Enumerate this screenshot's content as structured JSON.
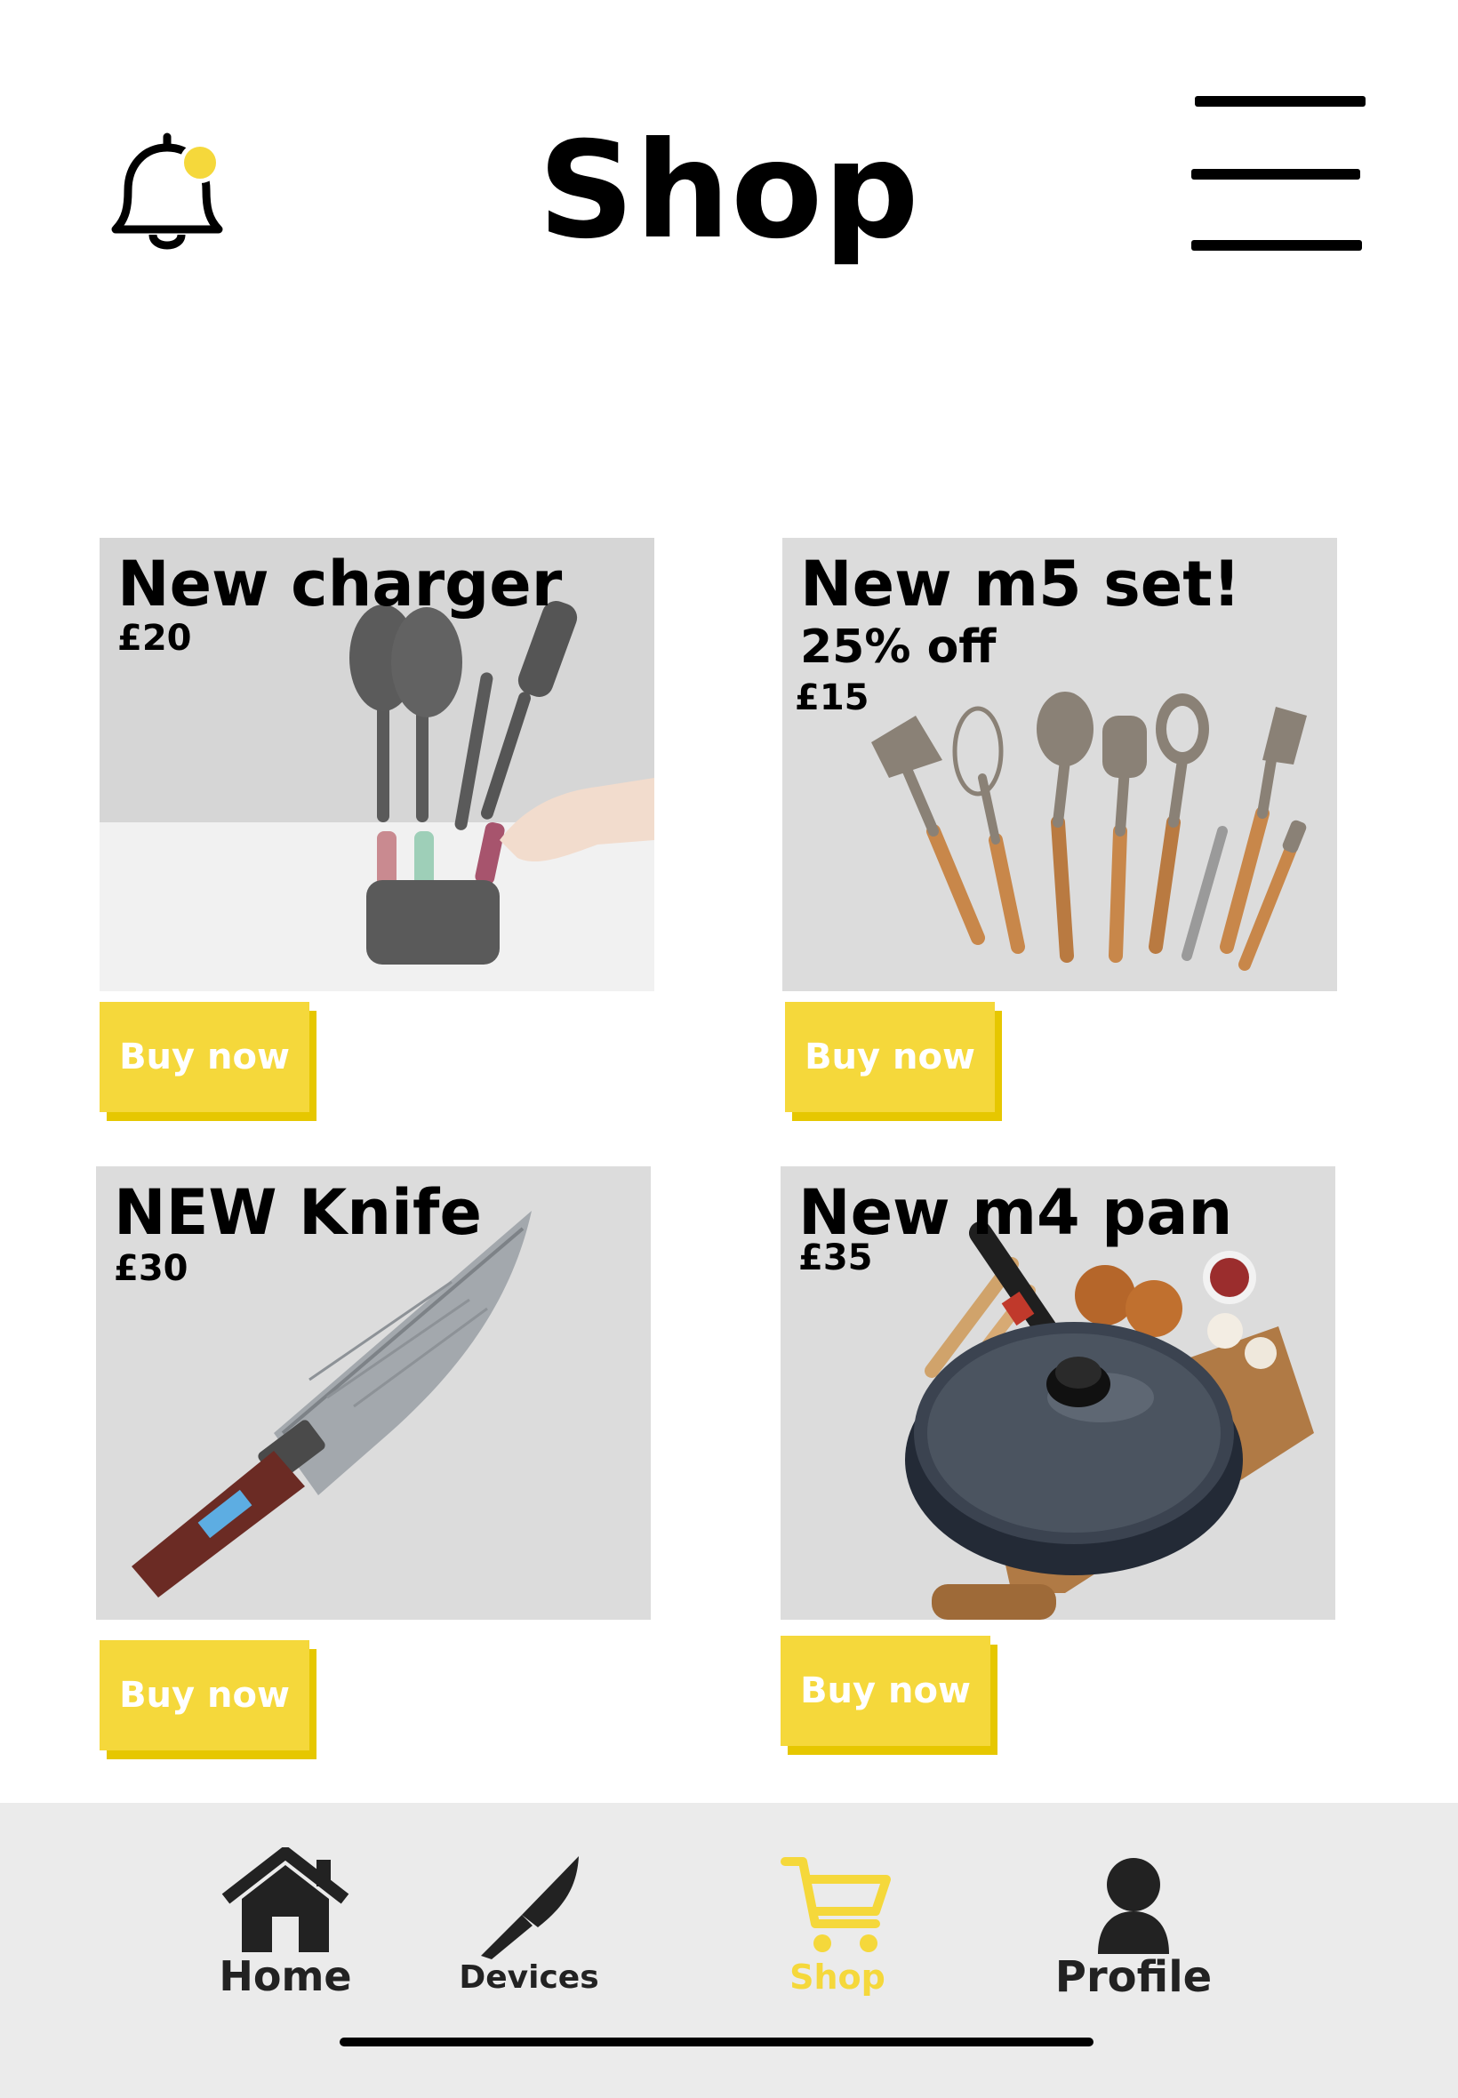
{
  "header": {
    "title": "Shop",
    "bell_icon": "bell-icon",
    "menu_icon": "hamburger-menu-icon",
    "notification_dot_color": "#f5d83b"
  },
  "products": [
    {
      "name": "New charger",
      "price": "£20",
      "subtitle": "",
      "button": "Buy now",
      "image": "utensil-set-in-holder"
    },
    {
      "name": "New m5 set!",
      "subtitle": "25% off",
      "price": "£15",
      "button": "Buy now",
      "image": "wooden-handle-utensil-set"
    },
    {
      "name": "NEW Knife",
      "price": "£30",
      "subtitle": "",
      "button": "Buy now",
      "image": "damascus-chef-knife"
    },
    {
      "name": "New m4 pan",
      "price": "£35",
      "subtitle": "",
      "button": "Buy now",
      "image": "frying-pan-with-lid"
    }
  ],
  "nav": {
    "items": [
      {
        "label": "Home",
        "icon": "house-icon",
        "active": false
      },
      {
        "label": "Devices",
        "icon": "knife-icon",
        "active": false
      },
      {
        "label": "Shop",
        "icon": "cart-icon",
        "active": true
      },
      {
        "label": "Profile",
        "icon": "person-icon",
        "active": false
      }
    ],
    "active_color": "#f5d83b",
    "inactive_color": "#222222"
  },
  "colors": {
    "accent": "#f5d83b",
    "card_background": "#dcdcdc",
    "nav_background": "#ebebeb"
  }
}
